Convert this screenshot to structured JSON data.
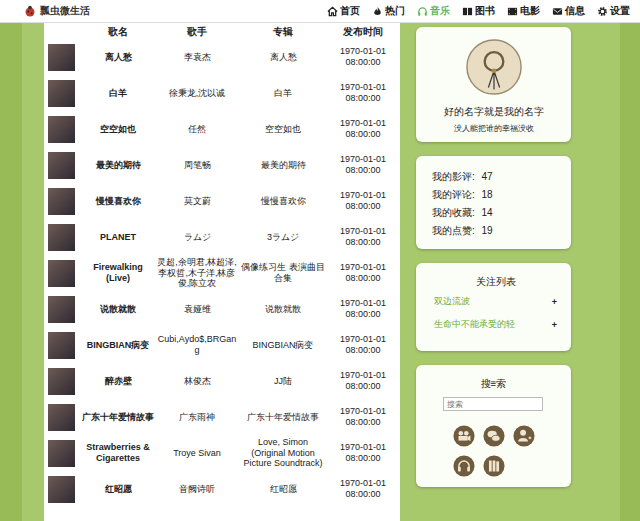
{
  "app": {
    "title": "瓢虫微生活"
  },
  "nav": [
    {
      "label": "首页",
      "selected": false
    },
    {
      "label": "热门",
      "selected": false
    },
    {
      "label": "音乐",
      "selected": true
    },
    {
      "label": "图书",
      "selected": false
    },
    {
      "label": "电影",
      "selected": false
    },
    {
      "label": "信息",
      "selected": false
    },
    {
      "label": "设置",
      "selected": false
    }
  ],
  "table": {
    "columns": [
      "歌名",
      "歌手",
      "专辑",
      "发布时间"
    ],
    "rows": [
      {
        "title": "离人愁",
        "artist": "李袁杰",
        "album": "离人愁",
        "released": "1970-01-01 08:00:00"
      },
      {
        "title": "白羊",
        "artist": "徐秉龙,沈以诚",
        "album": "白羊",
        "released": "1970-01-01 08:00:00"
      },
      {
        "title": "空空如也",
        "artist": "任然",
        "album": "空空如也",
        "released": "1970-01-01 08:00:00"
      },
      {
        "title": "最美的期待",
        "artist": "周笔畅",
        "album": "最美的期待",
        "released": "1970-01-01 08:00:00"
      },
      {
        "title": "慢慢喜欢你",
        "artist": "莫文蔚",
        "album": "慢慢喜欢你",
        "released": "1970-01-01 08:00:00"
      },
      {
        "title": "PLANET",
        "artist": "ラムジ",
        "album": "3ラムジ",
        "released": "1970-01-01 08:00:00"
      },
      {
        "title": "Firewalking (Live)",
        "artist": "灵超,余明君,林超泽,李权哲,木子洋,林彦俊,陈立农",
        "album": "偶像练习生 表演曲目合集",
        "released": "1970-01-01 08:00:00"
      },
      {
        "title": "说散就散",
        "artist": "袁娅维",
        "album": "说散就散",
        "released": "1970-01-01 08:00:00"
      },
      {
        "title": "BINGBIAN病变",
        "artist": "Cubi,Aydo$,BRGang",
        "album": "BINGBIAN病变",
        "released": "1970-01-01 08:00:00"
      },
      {
        "title": "醉赤壁",
        "artist": "林俊杰",
        "album": "JJ陆",
        "released": "1970-01-01 08:00:00"
      },
      {
        "title": "广东十年爱情故事",
        "artist": "广东雨神",
        "album": "广东十年爱情故事",
        "released": "1970-01-01 08:00:00"
      },
      {
        "title": "Strawberries & Cigarettes",
        "artist": "Troye Sivan",
        "album": "Love, Simon (Original Motion Picture Soundtrack)",
        "released": "1970-01-01 08:00:00"
      },
      {
        "title": "红昭愿",
        "artist": "音阙诗听",
        "album": "红昭愿",
        "released": "1970-01-01 08:00:00"
      }
    ]
  },
  "profile": {
    "name": "好的名字就是我的名字",
    "motto": "没人能把谁的幸福没收"
  },
  "stats": [
    {
      "label": "我的影评:",
      "value": "47"
    },
    {
      "label": "我的评论:",
      "value": "18"
    },
    {
      "label": "我的收藏:",
      "value": "14"
    },
    {
      "label": "我的点赞:",
      "value": "19"
    }
  ],
  "follow": {
    "title": "关注列表",
    "items": [
      {
        "name": "双边流波",
        "action": "+"
      },
      {
        "name": "生命中不能承受的轻",
        "action": "+"
      }
    ]
  },
  "search": {
    "title": "搜≡索",
    "placeholder": "搜索"
  }
}
